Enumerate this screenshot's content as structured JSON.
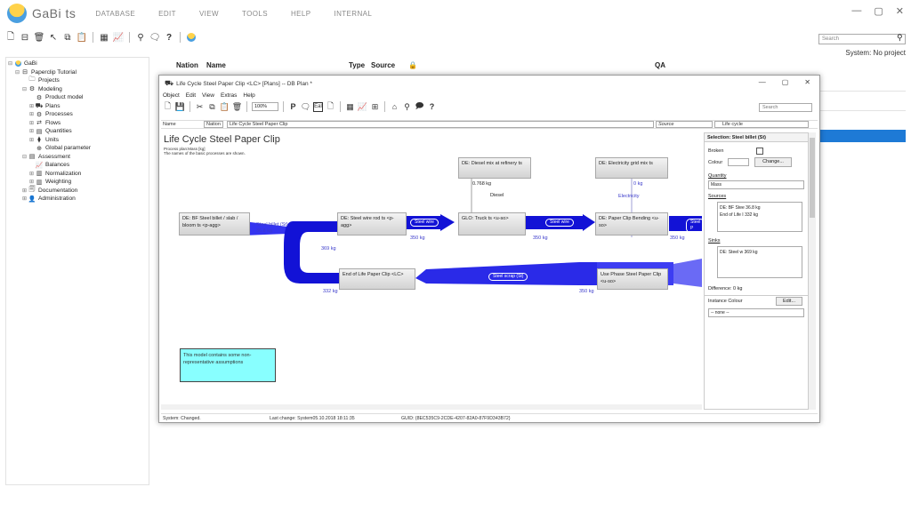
{
  "app": {
    "name": "GaBi ts",
    "menu": [
      "DATABASE",
      "EDIT",
      "VIEW",
      "TOOLS",
      "HELP",
      "INTERNAL"
    ]
  },
  "window_controls": [
    "—",
    "▢",
    "✕"
  ],
  "search": {
    "placeholder": "Search"
  },
  "system_info": "System: No project",
  "tree": [
    {
      "label": "GaBi",
      "icon": "gabi-icon",
      "level": 0
    },
    {
      "label": "Paperclip Tutorial",
      "icon": "database-icon",
      "level": 1
    },
    {
      "label": "Projects",
      "icon": "projects-icon",
      "level": 2
    },
    {
      "label": "Modeling",
      "icon": "modeling-icon",
      "level": 2
    },
    {
      "label": "Product model",
      "icon": "product-model-icon",
      "level": 3
    },
    {
      "label": "Plans",
      "icon": "plans-icon",
      "level": 3
    },
    {
      "label": "Processes",
      "icon": "processes-icon",
      "level": 3
    },
    {
      "label": "Flows",
      "icon": "flows-icon",
      "level": 3
    },
    {
      "label": "Quantities",
      "icon": "quantities-icon",
      "level": 3
    },
    {
      "label": "Units",
      "icon": "units-icon",
      "level": 3
    },
    {
      "label": "Global parameter",
      "icon": "global-parameter-icon",
      "level": 3
    },
    {
      "label": "Assessment",
      "icon": "assessment-icon",
      "level": 2
    },
    {
      "label": "Balances",
      "icon": "balances-icon",
      "level": 3
    },
    {
      "label": "Normalization",
      "icon": "normalization-icon",
      "level": 3
    },
    {
      "label": "Weighting",
      "icon": "weighting-icon",
      "level": 3
    },
    {
      "label": "Documentation",
      "icon": "documentation-icon",
      "level": 2
    },
    {
      "label": "Administration",
      "icon": "administration-icon",
      "level": 2
    }
  ],
  "table": {
    "headers": [
      "Nation",
      "Name",
      "Type",
      "Source",
      "🔒",
      "QA"
    ]
  },
  "plan": {
    "title": "Life Cycle Steel Paper Clip <LC> [Plans] -- DB Plan *",
    "menu": [
      "Object",
      "Edit",
      "View",
      "Extras",
      "Help"
    ],
    "zoom": "100%",
    "search_placeholder": "Search",
    "filter": {
      "name_label": "Name",
      "nation": "Nation",
      "plan_name": "Life Cycle Steel Paper Clip",
      "source": "Source",
      "type": "Life cycle"
    },
    "diagram_title": "Life Cycle Steel Paper Clip",
    "subtitle1": "Process plan:Mass [kg]",
    "subtitle2": "The names of the basic processes are shown.",
    "boxes": {
      "bf": "DE: BF Steel billet / slab / bloom ts <p-agg>",
      "wirerod": "DE: Steel wire rod ts <p-agg>",
      "truck": "GLO: Truck ts <u-so>",
      "bending": "DE: Paper Clip Bending <u-so>",
      "diesel": "DE: Diesel mix at refinery ts",
      "electricity": "DE: Electricity grid mix ts",
      "eol": "End of Life Paper Clip <LC>",
      "usephase": "Use Phase Steel Paper Clip <u-so>"
    },
    "flows": {
      "steel_billet": "Steel billet (St)",
      "steel_billet_amt": "36.8 kg",
      "amt_369": "369 kg",
      "steel_wire": "Steel wire",
      "amt_350a": "350 kg",
      "amt_350b": "350 kg",
      "amt_350c": "350 kg",
      "steel_wire2": "Steel wire",
      "steel_p": "Steel P",
      "diesel_amt": "0.768 kg",
      "diesel": "Diesel",
      "electricity_amt": "0 kg",
      "electricity": "Electricity",
      "scrap": "Steel scrap (St)",
      "amt_332": "332 kg",
      "amt_350d": "350 kg"
    },
    "note": "This model contains some non-representative assumptions",
    "status": {
      "state": "System: Changed.",
      "last_change": "Last change: System05.10.2018 18:11:35",
      "guid": "GUID: {8EC535C9-2CDE-4207-82A0-87F9D343B72}"
    }
  },
  "panel": {
    "title": "Selection: Steel billet (St)",
    "broken": "Broken",
    "colour": "Colour",
    "change": "Change...",
    "quantity_label": "Quantity",
    "quantity_value": "Mass",
    "sources_label": "Sources",
    "sources": [
      "DE: BF Stee  36.8 kg",
      "End of Life I  332 kg"
    ],
    "sinks_label": "Sinks",
    "sinks": [
      "DE: Steel w  369 kg"
    ],
    "difference": "Difference: 0 kg",
    "instance_colour": "Instance Colour",
    "edit": "Edit...",
    "none": "-- none --"
  },
  "colors": {
    "flow_blue": "#1212d6",
    "select_blue": "#1e7ad6",
    "note_cyan": "#88ffff"
  }
}
